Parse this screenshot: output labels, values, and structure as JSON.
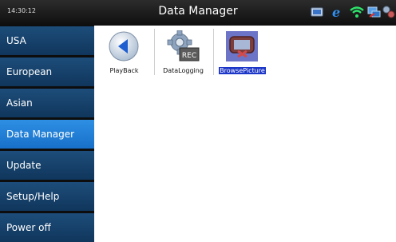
{
  "status_bar": {
    "time": "14:30:12",
    "title": "Data Manager",
    "tray_icons": [
      "screen-icon",
      "browser-icon",
      "wifi-icon",
      "network-icon",
      "settings-icon"
    ]
  },
  "sidebar": {
    "items": [
      {
        "label": "USA"
      },
      {
        "label": "European"
      },
      {
        "label": "Asian"
      },
      {
        "label": "Data Manager",
        "active": true
      },
      {
        "label": "Update"
      },
      {
        "label": "Setup/Help"
      },
      {
        "label": "Power off"
      }
    ]
  },
  "apps": [
    {
      "label": "PlayBack",
      "icon": "back-arrow-icon"
    },
    {
      "label": "DataLogging",
      "icon": "gear-rec-icon",
      "badge": "REC"
    },
    {
      "label": "BrowsePicture",
      "icon": "picture-device-icon",
      "selected": true
    }
  ],
  "colors": {
    "sidebar_item": "#10365c",
    "sidebar_active": "#1870c8",
    "selection": "#1c36c8"
  }
}
